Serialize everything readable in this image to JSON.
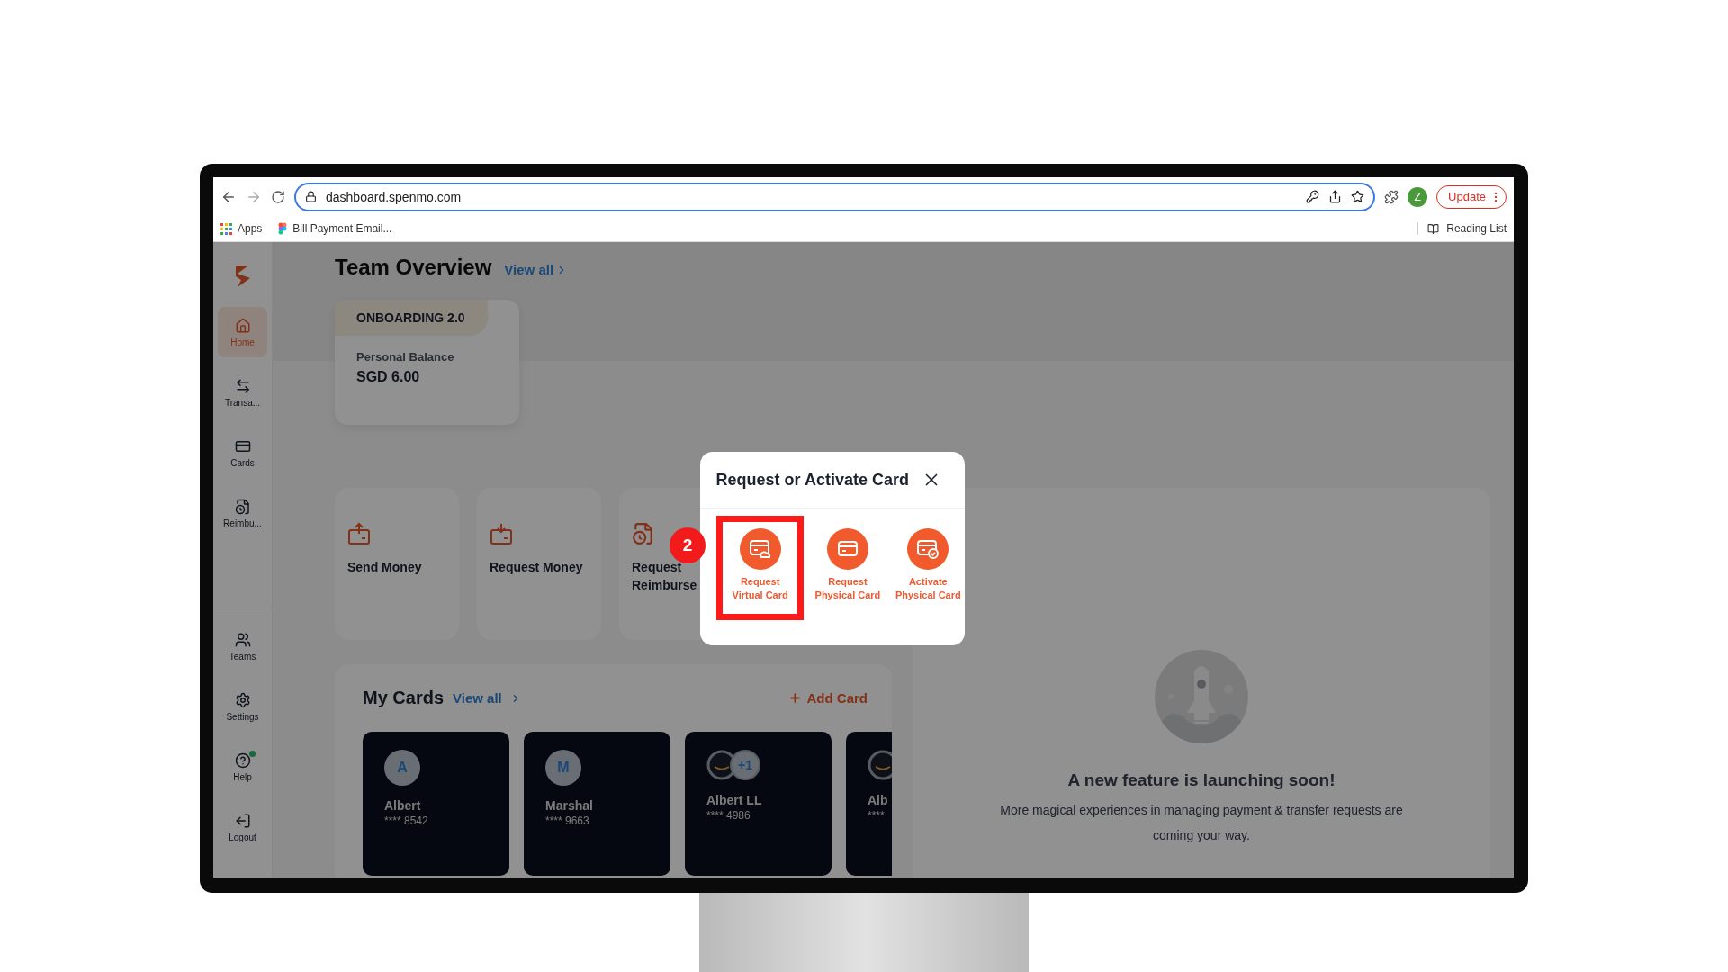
{
  "browser": {
    "url": "dashboard.spenmo.com",
    "profile_initial": "Z",
    "update_label": "Update",
    "reading_list": "Reading List",
    "bookmarks": [
      {
        "label": "Apps",
        "kind": "apps"
      },
      {
        "label": "Bill Payment Email...",
        "kind": "figma"
      }
    ]
  },
  "sidebar": {
    "items": [
      {
        "label": "Home",
        "kind": "home",
        "selected": true
      },
      {
        "label": "Transa...",
        "kind": "transfer",
        "selected": false
      },
      {
        "label": "Cards",
        "kind": "card",
        "selected": false
      },
      {
        "label": "Reimbu...",
        "kind": "reimburse",
        "selected": false
      }
    ],
    "bottom_items": [
      {
        "label": "Teams",
        "kind": "teams",
        "notification": false
      },
      {
        "label": "Settings",
        "kind": "settings",
        "notification": false
      },
      {
        "label": "Help",
        "kind": "help",
        "notification": true
      },
      {
        "label": "Logout",
        "kind": "logout",
        "notification": false
      }
    ]
  },
  "team_overview": {
    "title": "Team Overview",
    "link": "View all",
    "team": {
      "name": "ONBOARDING 2.0",
      "balance_label": "Personal Balance",
      "balance": "SGD 6.00"
    }
  },
  "actions": [
    {
      "label": "Send Money",
      "kind": "send"
    },
    {
      "label": "Request Money",
      "kind": "request"
    },
    {
      "label": "Request\nReimburse",
      "kind": "reimburse"
    }
  ],
  "my_cards": {
    "title": "My Cards",
    "link": "View all",
    "add": "Add Card",
    "cards": [
      {
        "kind": "initial",
        "avatar": "A",
        "name": "Albert",
        "number": "**** 8542"
      },
      {
        "kind": "initial",
        "avatar": "M",
        "name": "Marshal",
        "number": "**** 9663"
      },
      {
        "kind": "merchant",
        "extra": "+1",
        "name": "Albert LL",
        "number": "**** 4986"
      },
      {
        "kind": "merchant",
        "name": "Alb",
        "number": "****"
      }
    ]
  },
  "feature": {
    "title": "A new feature is launching soon!",
    "text": "More magical experiences in managing payment & transfer requests are coming your way."
  },
  "modal": {
    "title": "Request or Activate Card",
    "step": "2",
    "options": [
      {
        "label": "Request\nVirtual Card",
        "kind": "virtual",
        "selected": true
      },
      {
        "label": "Request\nPhysical Card",
        "kind": "physical",
        "selected": false
      },
      {
        "label": "Activate\nPhysical Card",
        "kind": "activate",
        "selected": false
      }
    ]
  }
}
